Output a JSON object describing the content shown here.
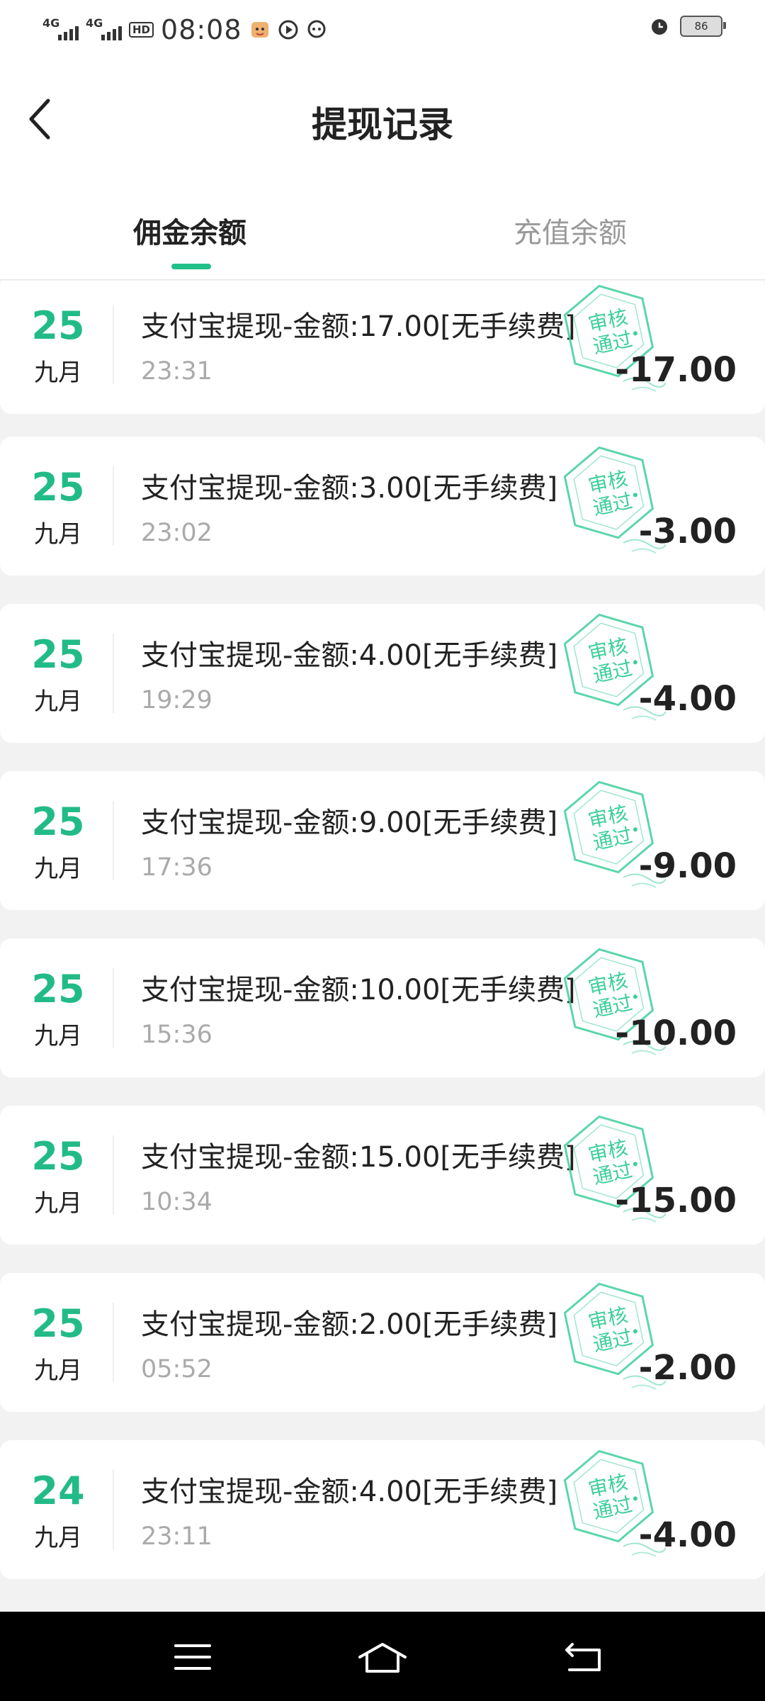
{
  "status_bar": {
    "network1": "4G",
    "network2": "4G",
    "hd": "HD",
    "time": "08:08",
    "battery": "86"
  },
  "header": {
    "title": "提现记录"
  },
  "tabs": [
    {
      "label": "佣金余额"
    },
    {
      "label": "充值余额"
    }
  ],
  "stamp_text": {
    "line1": "审核",
    "line2": "通过"
  },
  "records": [
    {
      "day": "25",
      "month": "九月",
      "desc": "支付宝提现-金额:17.00[无手续费]",
      "time": "23:31",
      "amount": "-17.00"
    },
    {
      "day": "25",
      "month": "九月",
      "desc": "支付宝提现-金额:3.00[无手续费]",
      "time": "23:02",
      "amount": "-3.00"
    },
    {
      "day": "25",
      "month": "九月",
      "desc": "支付宝提现-金额:4.00[无手续费]",
      "time": "19:29",
      "amount": "-4.00"
    },
    {
      "day": "25",
      "month": "九月",
      "desc": "支付宝提现-金额:9.00[无手续费]",
      "time": "17:36",
      "amount": "-9.00"
    },
    {
      "day": "25",
      "month": "九月",
      "desc": "支付宝提现-金额:10.00[无手续费]",
      "time": "15:36",
      "amount": "-10.00"
    },
    {
      "day": "25",
      "month": "九月",
      "desc": "支付宝提现-金额:15.00[无手续费]",
      "time": "10:34",
      "amount": "-15.00"
    },
    {
      "day": "25",
      "month": "九月",
      "desc": "支付宝提现-金额:2.00[无手续费]",
      "time": "05:52",
      "amount": "-2.00"
    },
    {
      "day": "24",
      "month": "九月",
      "desc": "支付宝提现-金额:4.00[无手续费]",
      "time": "23:11",
      "amount": "-4.00"
    }
  ],
  "colors": {
    "accent": "#22bb88",
    "stamp": "#3ecf9a"
  },
  "icons": {
    "back": "chevron-left-icon",
    "menu": "menu-icon",
    "home": "home-icon",
    "return": "back-arrow-icon"
  }
}
